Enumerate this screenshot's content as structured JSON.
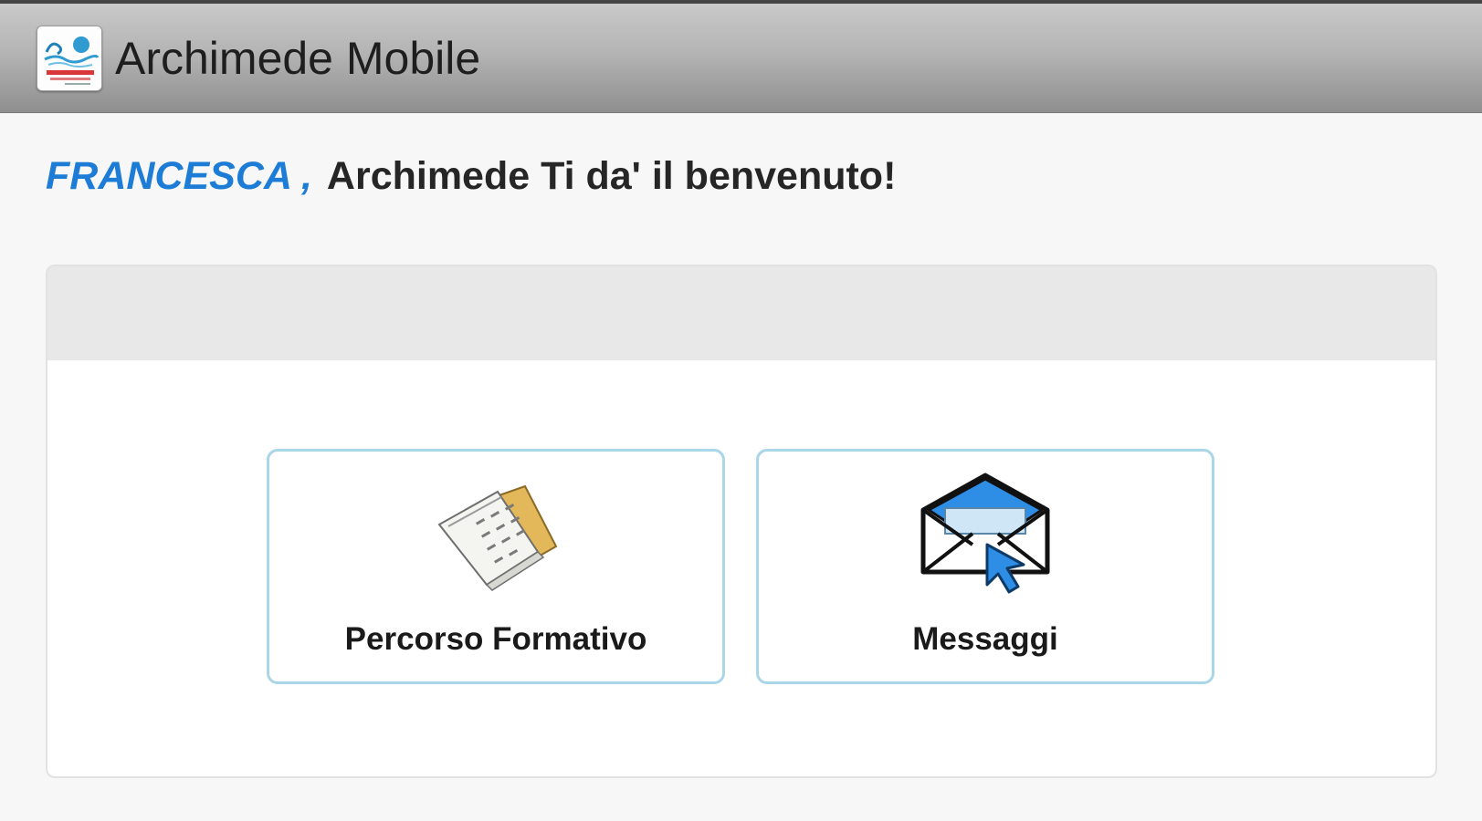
{
  "app": {
    "title": "Archimede Mobile",
    "icon": "archimede-logo-icon"
  },
  "welcome": {
    "user": "FRANCESCA",
    "separator": ",",
    "message": "Archimede Ti da' il benvenuto!"
  },
  "menu": {
    "items": [
      {
        "label": "Percorso Formativo",
        "icon": "documents-icon"
      },
      {
        "label": "Messaggi",
        "icon": "envelope-cursor-icon"
      }
    ]
  },
  "colors": {
    "accent": "#1d7dd6",
    "tile_border": "#a9d6e8",
    "action_bar_top": "#c9c9c9",
    "action_bar_bottom": "#8f8f8f"
  }
}
